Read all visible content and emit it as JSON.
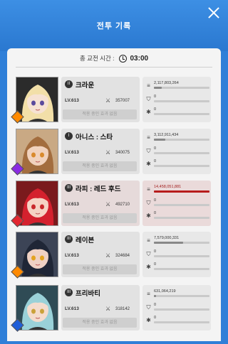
{
  "title": "전투 기록",
  "total_time_label": "총 교전 시간 :",
  "total_time": "03:00",
  "status_effect_text": "적용 중인 효과 없음",
  "members": [
    {
      "name": "크라운",
      "rank": "II",
      "level": "LV.613",
      "power": "357007",
      "damage": "2,117,803,264",
      "damage_ratio": 0.14,
      "defense": "0",
      "heal": "0",
      "class_color": "#ff8a00",
      "hair": "#f2dfa8",
      "skin": "#f6e2d3",
      "eyes": "#5a4a9c",
      "bg": "#2b2b2b"
    },
    {
      "name": "아니스 : 스타",
      "rank": "I",
      "level": "LV.613",
      "power": "340075",
      "damage": "3,112,911,434",
      "damage_ratio": 0.21,
      "defense": "0",
      "heal": "0",
      "class_color": "#8a2be2",
      "hair": "#a36d3e",
      "skin": "#f1d2bd",
      "eyes": "#d98a2d",
      "bg": "#c9a984"
    },
    {
      "name": "라피 : 레드 후드",
      "rank": "III",
      "level": "LV.613",
      "power": "492710",
      "damage": "14,458,051,881",
      "damage_ratio": 1.0,
      "defense": "0",
      "heal": "0",
      "class_color": "#e32630",
      "hair": "#d4212e",
      "skin": "#f5d3c4",
      "eyes": "#c9282b",
      "bg": "#7a1a1d",
      "highlight": true
    },
    {
      "name": "레이븐",
      "rank": "III",
      "level": "LV.613",
      "power": "324684",
      "damage": "7,579,000,331",
      "damage_ratio": 0.52,
      "defense": "0",
      "heal": "0",
      "class_color": "#ff8a00",
      "hair": "#1f2636",
      "skin": "#efd1c3",
      "eyes": "#e3a321",
      "bg": "#3c4456"
    },
    {
      "name": "프리바티",
      "rank": "III",
      "level": "LV.613",
      "power": "318142",
      "damage": "631,064,219",
      "damage_ratio": 0.04,
      "defense": "0",
      "heal": "0",
      "class_color": "#1f5ed8",
      "hair": "#9ad1d8",
      "skin": "#f4dccd",
      "eyes": "#caa23a",
      "bg": "#2f4b55"
    }
  ],
  "icons": {
    "close": "close-icon",
    "clock": "clock-icon",
    "damage": "damage-bars-icon",
    "defense": "shield-icon",
    "heal": "heal-cross-icon",
    "power": "crossed-swords-icon",
    "class": "class-diamond-icon"
  }
}
